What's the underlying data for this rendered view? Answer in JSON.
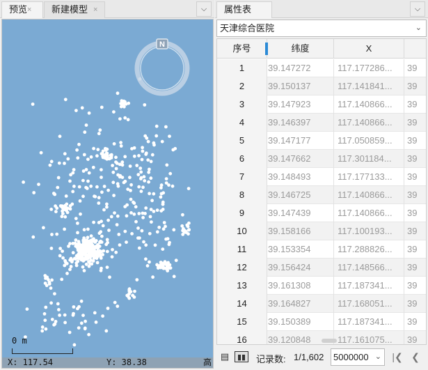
{
  "left_panel": {
    "tabs": [
      {
        "label": "预览",
        "close": "×"
      },
      {
        "label": "新建模型",
        "close": "×"
      }
    ],
    "dropdown_icon": "chevron-down-icon",
    "map": {
      "background_color": "#7baad3",
      "point_color": "#ffffff",
      "compass_label": "N",
      "scale_label": "0 m",
      "status": {
        "x": "X: 117.54",
        "y": "Y: 38.38",
        "h": "高"
      }
    }
  },
  "right_panel": {
    "tab": {
      "label": "属性表"
    },
    "layer_select": {
      "value": "天津综合医院"
    },
    "table": {
      "columns": [
        "序号",
        "纬度",
        "X",
        ""
      ],
      "rows": [
        {
          "seq": "1",
          "lat": "39.147272",
          "x": "117.177286...",
          "y": "39"
        },
        {
          "seq": "2",
          "lat": "39.150137",
          "x": "117.141841...",
          "y": "39"
        },
        {
          "seq": "3",
          "lat": "39.147923",
          "x": "117.140866...",
          "y": "39"
        },
        {
          "seq": "4",
          "lat": "39.146397",
          "x": "117.140866...",
          "y": "39"
        },
        {
          "seq": "5",
          "lat": "39.147177",
          "x": "117.050859...",
          "y": "39"
        },
        {
          "seq": "6",
          "lat": "39.147662",
          "x": "117.301184...",
          "y": "39"
        },
        {
          "seq": "7",
          "lat": "39.148493",
          "x": "117.177133...",
          "y": "39"
        },
        {
          "seq": "8",
          "lat": "39.146725",
          "x": "117.140866...",
          "y": "39"
        },
        {
          "seq": "9",
          "lat": "39.147439",
          "x": "117.140866...",
          "y": "39"
        },
        {
          "seq": "10",
          "lat": "39.158166",
          "x": "117.100193...",
          "y": "39"
        },
        {
          "seq": "11",
          "lat": "39.153354",
          "x": "117.288826...",
          "y": "39"
        },
        {
          "seq": "12",
          "lat": "39.156424",
          "x": "117.148566...",
          "y": "39"
        },
        {
          "seq": "13",
          "lat": "39.161308",
          "x": "117.187341...",
          "y": "39"
        },
        {
          "seq": "14",
          "lat": "39.164827",
          "x": "117.168051...",
          "y": "39"
        },
        {
          "seq": "15",
          "lat": "39.150389",
          "x": "117.187341...",
          "y": "39"
        },
        {
          "seq": "16",
          "lat": "39.120848",
          "x": "117.161075...",
          "y": "39"
        }
      ]
    },
    "footer": {
      "count_label": "记录数:",
      "count_value": "1/1,602",
      "page_size": "5000000",
      "first_icon": "first-page-icon",
      "prev_icon": "prev-page-icon"
    }
  }
}
